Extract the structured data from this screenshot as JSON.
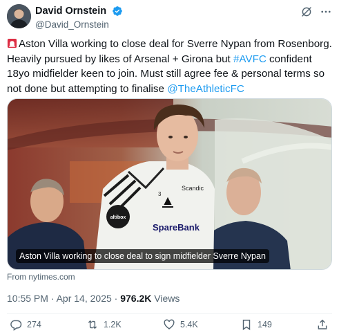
{
  "author": {
    "display_name": "David Ornstein",
    "handle": "@David_Ornstein",
    "verified_badge_icon": "verified-badge-icon",
    "avatar_icon": "avatar"
  },
  "header_actions": {
    "grok_icon": "grok-icon",
    "more_icon": "more-options-icon"
  },
  "tweet": {
    "text_part1": "Aston Villa working to close deal for Sverre Nypan from Rosenborg. Heavily pursued by likes of Arsenal + Girona but ",
    "hashtag": "#AVFC",
    "text_part2": " confident 18yo midfielder keen to join. Must still agree fee & personal terms so not done but attempting to finalise ",
    "mention": "@TheAthleticFC"
  },
  "media": {
    "caption": "Aston Villa working to close deal to sign midfielder Sverre Nypan",
    "shirt_sponsor": "SpareBank",
    "shirt_brand": "Scandic"
  },
  "card_source": "From nytimes.com",
  "meta": {
    "timestamp": "10:55 PM · Apr 14, 2025",
    "separator": " · ",
    "views_count": "976.2K",
    "views_label": " Views"
  },
  "actions": {
    "replies": "274",
    "reposts": "1.2K",
    "likes": "5.4K",
    "bookmarks": "149"
  },
  "colors": {
    "accent": "#1d9bf0",
    "text_primary": "#0f1419",
    "text_secondary": "#536471"
  }
}
